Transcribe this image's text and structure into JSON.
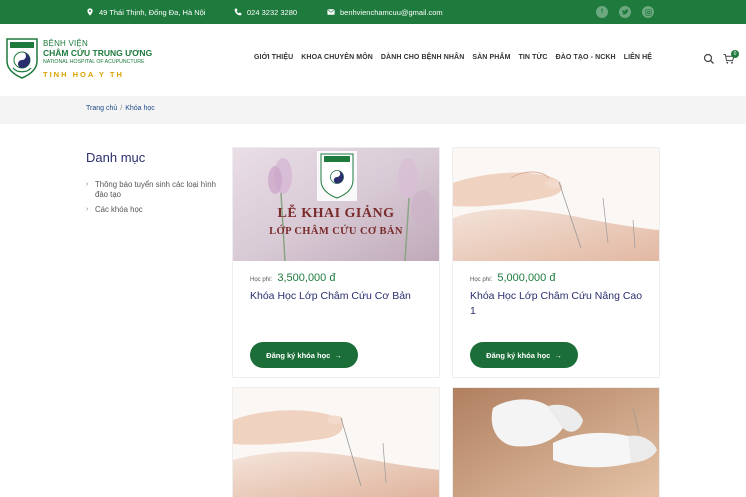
{
  "topbar": {
    "address": "49 Thái Thịnh, Đống Đa, Hà Nội",
    "phone": "024 3232 3280",
    "email": "benhvienchamcuu@gmail.com"
  },
  "logo": {
    "line1": "BỆNH VIỆN",
    "line2": "CHÂM CỨU TRUNG ƯƠNG",
    "line3": "NATIONAL HOSPITAL OF ACUPUNCTURE",
    "slogan": "TINH HOA Y TH",
    "emblem_small_text": "BỆNH VIỆN CHÂM CỨU TRUNG ƯƠNG"
  },
  "nav": {
    "items": [
      "GIỚI THIỆU",
      "KHOA CHUYÊN MÔN",
      "DÀNH CHO BỆNH NHÂN",
      "SẢN PHẨM",
      "TIN TỨC",
      "ĐÀO TẠO - NCKH",
      "LIÊN HỆ"
    ],
    "cart_count": "0"
  },
  "breadcrumb": {
    "home": "Trang chủ",
    "sep": "/",
    "current": "Khóa học"
  },
  "sidebar": {
    "title": "Danh mục",
    "items": [
      "Thông báo tuyển sinh các loại hình đào tạo",
      "Các khóa học"
    ]
  },
  "courses": [
    {
      "fee_label": "Học phí:",
      "fee": "3,500,000 đ",
      "title": "Khóa Học Lớp Châm Cứu Cơ Bản",
      "button": "Đăng ký khóa học",
      "banner_line1": "LỄ KHAI GIẢNG",
      "banner_line2": "LỚP CHÂM CỨU CƠ BẢN"
    },
    {
      "fee_label": "Học phí:",
      "fee": "5,000,000 đ",
      "title": "Khóa Học Lớp Châm Cứu Nâng Cao 1",
      "button": "Đăng ký khóa học"
    }
  ],
  "colors": {
    "brand_green": "#1e7a3d",
    "title_navy": "#2b2e6e",
    "slogan_gold": "#d8a300"
  }
}
